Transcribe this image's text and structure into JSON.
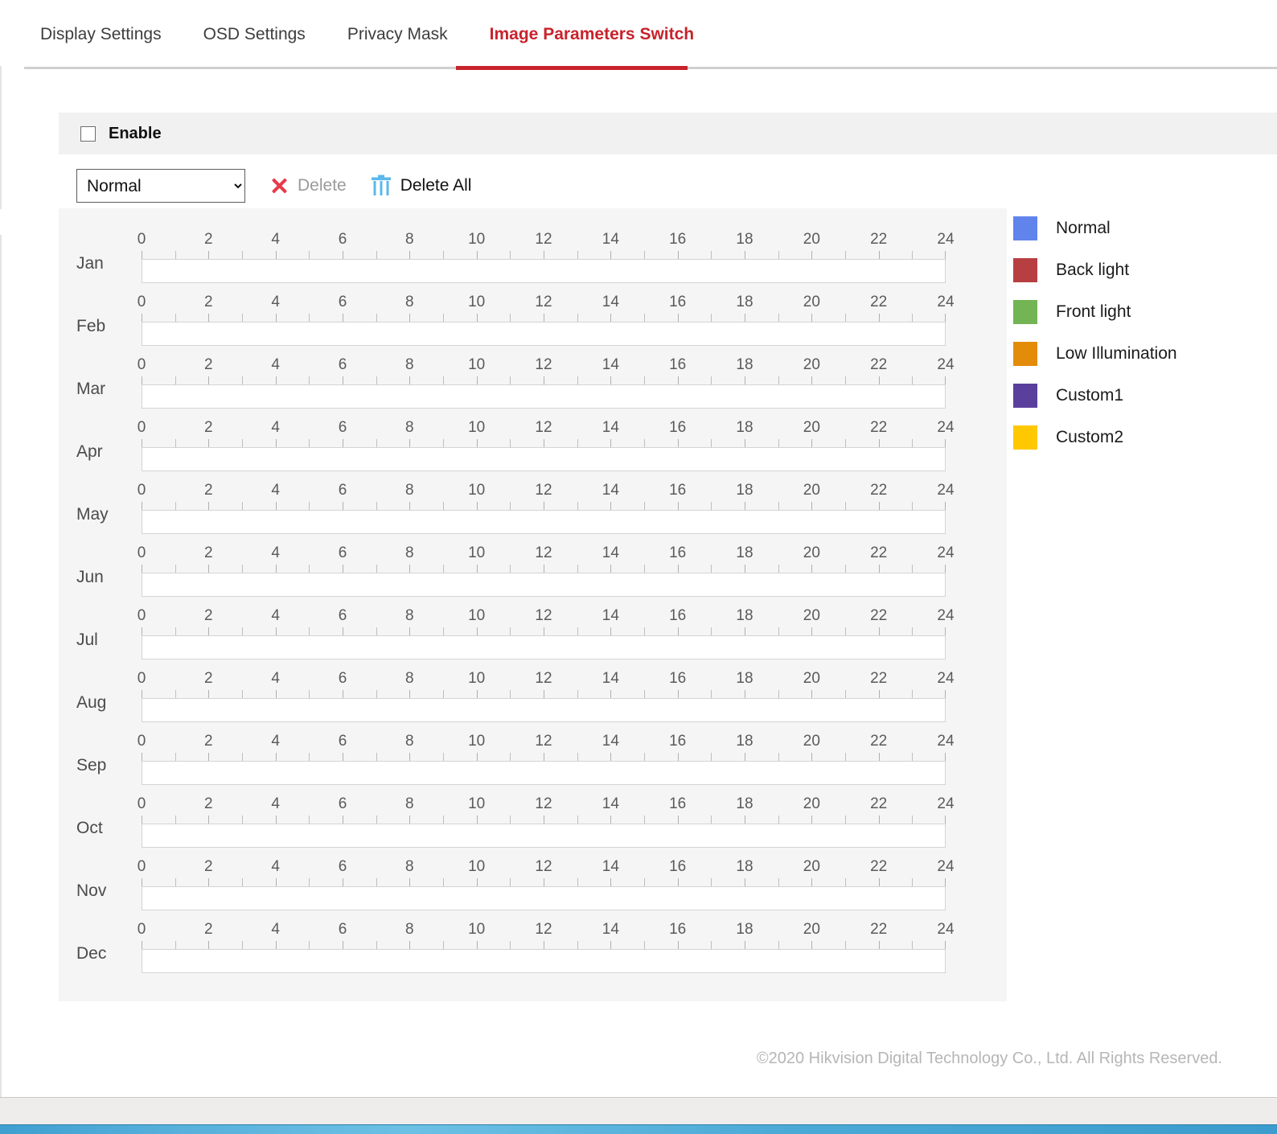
{
  "tabs": [
    {
      "label": "Display Settings",
      "active": false
    },
    {
      "label": "OSD Settings",
      "active": false
    },
    {
      "label": "Privacy Mask",
      "active": false
    },
    {
      "label": "Image Parameters Switch",
      "active": true
    }
  ],
  "enable": {
    "label": "Enable",
    "checked": false
  },
  "toolbar": {
    "mode_select": {
      "value": "Normal",
      "options": [
        "Normal",
        "Back light",
        "Front light",
        "Low Illumination",
        "Custom1",
        "Custom2"
      ]
    },
    "delete_label": "Delete",
    "delete_all_label": "Delete All",
    "delete_icon": "close-x-icon",
    "delete_all_icon": "trash-icon",
    "delete_enabled": false
  },
  "schedule": {
    "months": [
      "Jan",
      "Feb",
      "Mar",
      "Apr",
      "May",
      "Jun",
      "Jul",
      "Aug",
      "Sep",
      "Oct",
      "Nov",
      "Dec"
    ],
    "tick_labels": [
      "0",
      "2",
      "4",
      "6",
      "8",
      "10",
      "12",
      "14",
      "16",
      "18",
      "20",
      "22",
      "24"
    ],
    "hour_min": 0,
    "hour_max": 24,
    "tick_interval_hours": 1,
    "label_interval_hours": 2,
    "segments": []
  },
  "legend": [
    {
      "label": "Normal",
      "color": "#6183ec"
    },
    {
      "label": "Back light",
      "color": "#b73f42"
    },
    {
      "label": "Front light",
      "color": "#73b455"
    },
    {
      "label": "Low Illumination",
      "color": "#e38c0a"
    },
    {
      "label": "Custom1",
      "color": "#5b3f9d"
    },
    {
      "label": "Custom2",
      "color": "#ffc800"
    }
  ],
  "footer": {
    "copyright": "©2020 Hikvision Digital Technology Co., Ltd. All Rights Reserved."
  },
  "colors": {
    "accent_red": "#c8232c",
    "panel_bg": "#f5f5f5",
    "band_bg": "#f1f1f1",
    "delete_x": "#e8394a",
    "trash_blue": "#5bb8ec"
  }
}
